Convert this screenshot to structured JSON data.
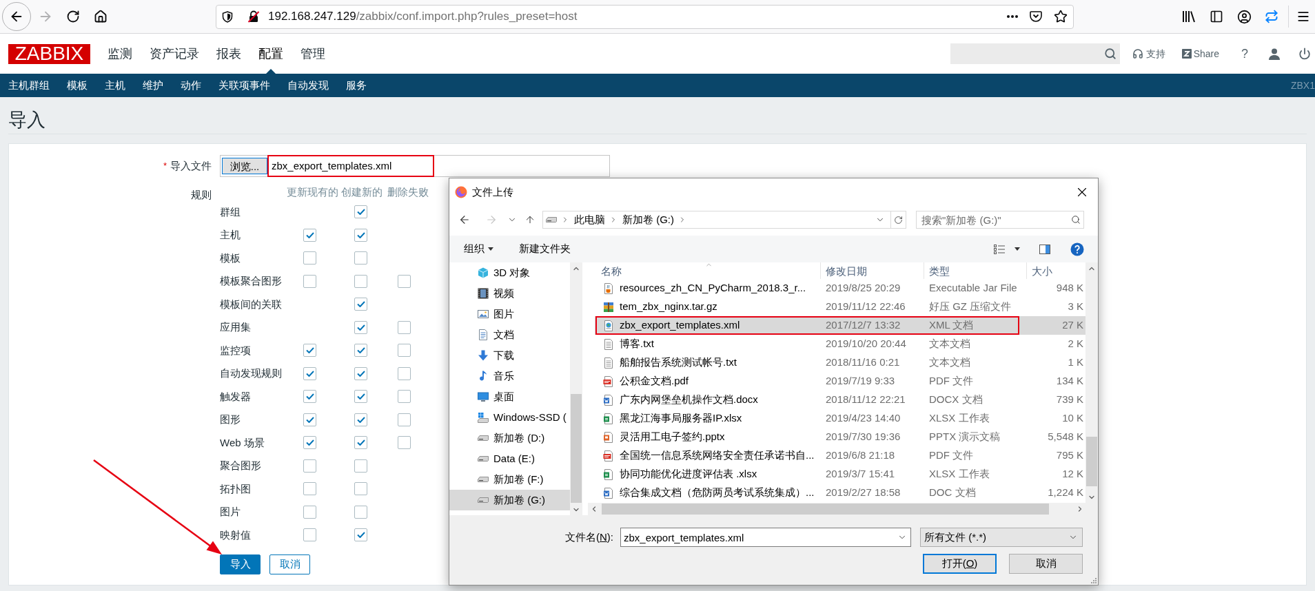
{
  "browser": {
    "url_host": "192.168.247.129",
    "url_path": "/zabbix/conf.import.php?rules_preset=host",
    "forward_disabled": true
  },
  "header": {
    "logo": "ZABBIX",
    "menu": [
      {
        "label": "监测",
        "selected": false
      },
      {
        "label": "资产记录",
        "selected": false
      },
      {
        "label": "报表",
        "selected": false
      },
      {
        "label": "配置",
        "selected": true
      },
      {
        "label": "管理",
        "selected": false
      }
    ],
    "support": "支持",
    "share": "Share",
    "help": "?"
  },
  "subnav": {
    "items": [
      "主机群组",
      "模板",
      "主机",
      "维护",
      "动作",
      "关联项事件",
      "自动发现",
      "服务"
    ],
    "server": "ZBX1"
  },
  "page": {
    "title": "导入"
  },
  "form": {
    "required_mark": "*",
    "file_label": "导入文件",
    "browse_button": "浏览...",
    "file_name": "zbx_export_templates.xml",
    "file_highlighted": true,
    "rules_label": "规则",
    "columns": [
      "更新现有的",
      "创建新的",
      "删除失败"
    ],
    "rules": [
      {
        "label": "群组",
        "create": true
      },
      {
        "label": "主机",
        "update": true,
        "create": true
      },
      {
        "label": "模板",
        "update": false,
        "create": false
      },
      {
        "label": "模板聚合图形",
        "update": false,
        "create": false,
        "delete": false
      },
      {
        "label": "模板间的关联",
        "create": true
      },
      {
        "label": "应用集",
        "create": true,
        "delete": false
      },
      {
        "label": "监控项",
        "update": true,
        "create": true,
        "delete": false
      },
      {
        "label": "自动发现规则",
        "update": true,
        "create": true,
        "delete": false
      },
      {
        "label": "触发器",
        "update": true,
        "create": true,
        "delete": false
      },
      {
        "label": "图形",
        "update": true,
        "create": true,
        "delete": false
      },
      {
        "label": "Web 场景",
        "update": true,
        "create": true,
        "delete": false
      },
      {
        "label": "聚合图形",
        "update": false,
        "create": false
      },
      {
        "label": "拓扑图",
        "update": false,
        "create": false
      },
      {
        "label": "图片",
        "update": false,
        "create": false
      },
      {
        "label": "映射值",
        "update": false,
        "create": true
      }
    ],
    "buttons": [
      {
        "label": "导入",
        "kind": "primary",
        "arrow": true
      },
      {
        "label": "取消",
        "kind": "secondary",
        "arrow": false
      }
    ]
  },
  "dialog": {
    "title": "文件上传",
    "forward_disabled": true,
    "path": [
      "此电脑",
      "新加卷 (G:)"
    ],
    "search_placeholder": "搜索\"新加卷 (G:)\"",
    "organize": "组织",
    "new_folder": "新建文件夹",
    "nav": [
      {
        "label": "3D 对象",
        "kind": "objects3d",
        "selected": false
      },
      {
        "label": "视频",
        "kind": "videos",
        "selected": false
      },
      {
        "label": "图片",
        "kind": "pictures",
        "selected": false
      },
      {
        "label": "文档",
        "kind": "documents",
        "selected": false
      },
      {
        "label": "下载",
        "kind": "downloads",
        "selected": false
      },
      {
        "label": "音乐",
        "kind": "music",
        "selected": false
      },
      {
        "label": "桌面",
        "kind": "desktop",
        "selected": false
      },
      {
        "label": "Windows-SSD (",
        "kind": "system",
        "selected": false
      },
      {
        "label": "新加卷 (D:)",
        "kind": "drive",
        "selected": false
      },
      {
        "label": "Data (E:)",
        "kind": "drive",
        "selected": false
      },
      {
        "label": "新加卷 (F:)",
        "kind": "drive",
        "selected": false
      },
      {
        "label": "新加卷 (G:)",
        "kind": "drive",
        "selected": true
      }
    ],
    "columns": [
      "名称",
      "修改日期",
      "类型",
      "大小"
    ],
    "files": [
      {
        "name": "resources_zh_CN_PyCharm_2018.3_r...",
        "date": "2019/8/25 20:29",
        "type": "Executable Jar File",
        "size": "948 K",
        "kind": "jar",
        "selected": false,
        "highlighted": false
      },
      {
        "name": "tem_zbx_nginx.tar.gz",
        "date": "2019/11/12 22:46",
        "type": "好压 GZ 压缩文件",
        "size": "3 K",
        "kind": "archive",
        "selected": false,
        "highlighted": false
      },
      {
        "name": "zbx_export_templates.xml",
        "date": "2017/12/7 13:32",
        "type": "XML 文档",
        "size": "27 K",
        "kind": "xml",
        "selected": true,
        "highlighted": true
      },
      {
        "name": "博客.txt",
        "date": "2019/10/20 20:44",
        "type": "文本文档",
        "size": "2 K",
        "kind": "text",
        "selected": false,
        "highlighted": false
      },
      {
        "name": "船舶报告系统测试帐号.txt",
        "date": "2018/11/16 0:21",
        "type": "文本文档",
        "size": "1 K",
        "kind": "text",
        "selected": false,
        "highlighted": false
      },
      {
        "name": "公积金文档.pdf",
        "date": "2019/7/19 9:33",
        "type": "PDF 文件",
        "size": "134 K",
        "kind": "pdf",
        "selected": false,
        "highlighted": false
      },
      {
        "name": "广东内网堡垒机操作文档.docx",
        "date": "2018/11/12 22:21",
        "type": "DOCX 文档",
        "size": "739 K",
        "kind": "word",
        "selected": false,
        "highlighted": false
      },
      {
        "name": "黑龙江海事局服务器IP.xlsx",
        "date": "2019/4/23 14:40",
        "type": "XLSX 工作表",
        "size": "10 K",
        "kind": "sheet",
        "selected": false,
        "highlighted": false
      },
      {
        "name": "灵活用工电子签约.pptx",
        "date": "2019/7/30 19:36",
        "type": "PPTX 演示文稿",
        "size": "5,548 K",
        "kind": "slides",
        "selected": false,
        "highlighted": false
      },
      {
        "name": "全国统一信息系统网络安全责任承诺书自...",
        "date": "2019/6/8 21:18",
        "type": "PDF 文件",
        "size": "795 K",
        "kind": "pdf",
        "selected": false,
        "highlighted": false
      },
      {
        "name": "协同功能优化进度评估表 .xlsx",
        "date": "2019/3/7 15:41",
        "type": "XLSX 工作表",
        "size": "12 K",
        "kind": "sheet",
        "selected": false,
        "highlighted": false
      },
      {
        "name": "综合集成文档（危防两员考试系统集成）...",
        "date": "2019/2/27 18:58",
        "type": "DOC 文档",
        "size": "1,224 K",
        "kind": "word",
        "selected": false,
        "highlighted": false
      }
    ],
    "file_name_label": {
      "before": "文件名(",
      "key": "N",
      "after": "):"
    },
    "file_name": "zbx_export_templates.xml",
    "filter": "所有文件 (*.*)",
    "open_button": {
      "before": "打开(",
      "key": "O",
      "after": ")"
    },
    "cancel_button": "取消"
  }
}
